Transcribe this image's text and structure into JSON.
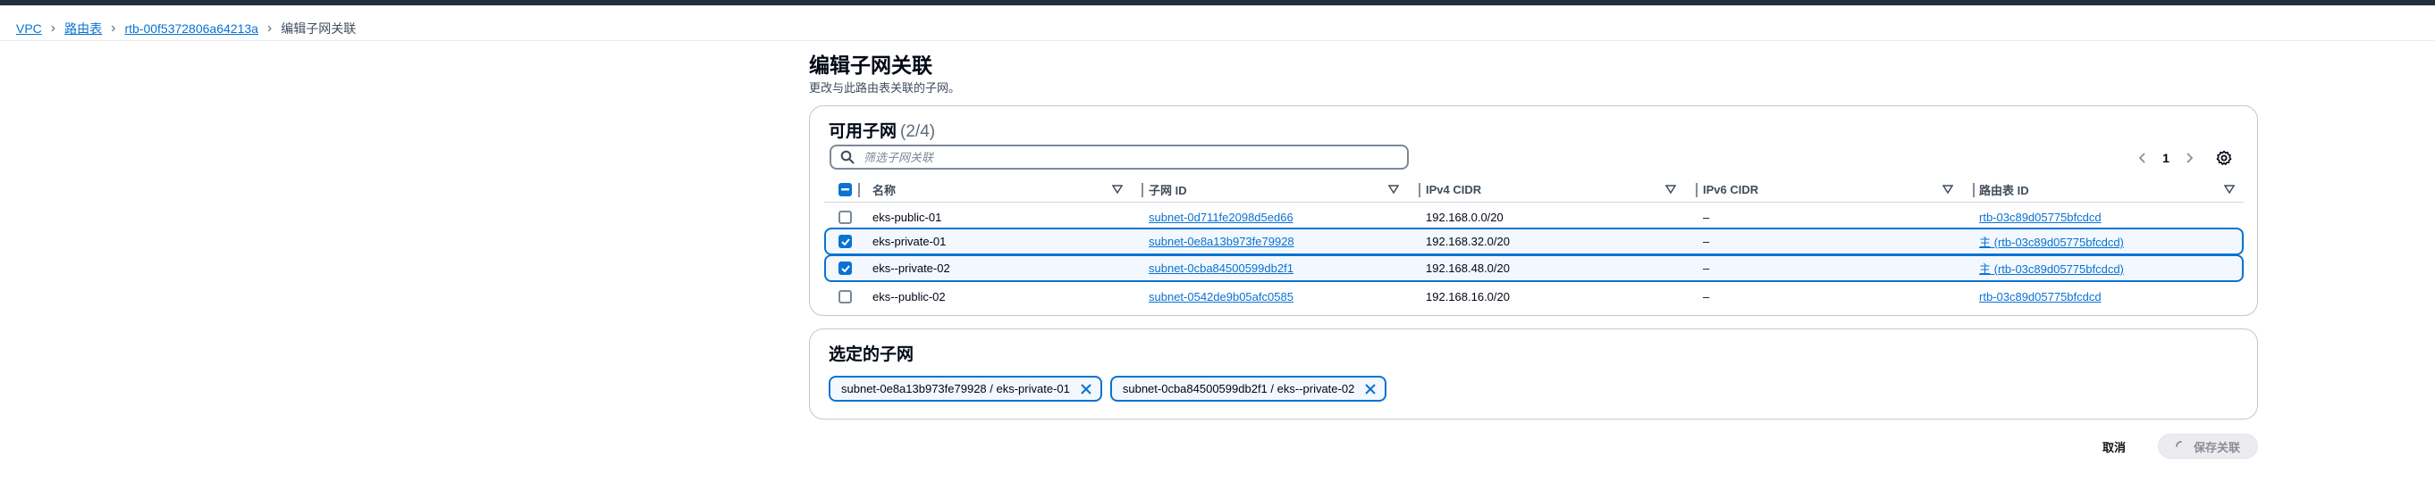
{
  "breadcrumb": {
    "items": [
      "VPC",
      "路由表",
      "rtb-00f5372806a64213a"
    ],
    "current": "编辑子网关联"
  },
  "page": {
    "title": "编辑子网关联",
    "description": "更改与此路由表关联的子网。"
  },
  "available": {
    "title": "可用子网",
    "count": "(2/4)",
    "search_placeholder": "筛选子网关联",
    "page_number": "1",
    "columns": [
      "名称",
      "子网 ID",
      "IPv4 CIDR",
      "IPv6 CIDR",
      "路由表 ID"
    ],
    "rows": [
      {
        "checked": false,
        "name": "eks-public-01",
        "subnet_id": "subnet-0d711fe2098d5ed66",
        "ipv4": "192.168.0.0/20",
        "ipv6": "–",
        "route_table": "rtb-03c89d05775bfcdcd"
      },
      {
        "checked": true,
        "name": "eks-private-01",
        "subnet_id": "subnet-0e8a13b973fe79928",
        "ipv4": "192.168.32.0/20",
        "ipv6": "–",
        "route_table": "主 (rtb-03c89d05775bfcdcd)"
      },
      {
        "checked": true,
        "name": "eks--private-02",
        "subnet_id": "subnet-0cba84500599db2f1",
        "ipv4": "192.168.48.0/20",
        "ipv6": "–",
        "route_table": "主 (rtb-03c89d05775bfcdcd)"
      },
      {
        "checked": false,
        "name": "eks--public-02",
        "subnet_id": "subnet-0542de9b05afc0585",
        "ipv4": "192.168.16.0/20",
        "ipv6": "–",
        "route_table": "rtb-03c89d05775bfcdcd"
      }
    ]
  },
  "selected": {
    "title": "选定的子网",
    "tokens": [
      "subnet-0e8a13b973fe79928 / eks-private-01",
      "subnet-0cba84500599db2f1 / eks--private-02"
    ]
  },
  "actions": {
    "cancel": "取消",
    "save": "保存关联"
  },
  "colors": {
    "accent": "#0972d3",
    "topbar": "#232f3e",
    "selected_row_bg": "#f2f8fd"
  },
  "icons": [
    "chevron-right-icon",
    "search-icon",
    "chevron-left-icon",
    "gear-icon",
    "sort-triangle-icon",
    "checkbox-icon",
    "close-icon",
    "loading-icon"
  ]
}
